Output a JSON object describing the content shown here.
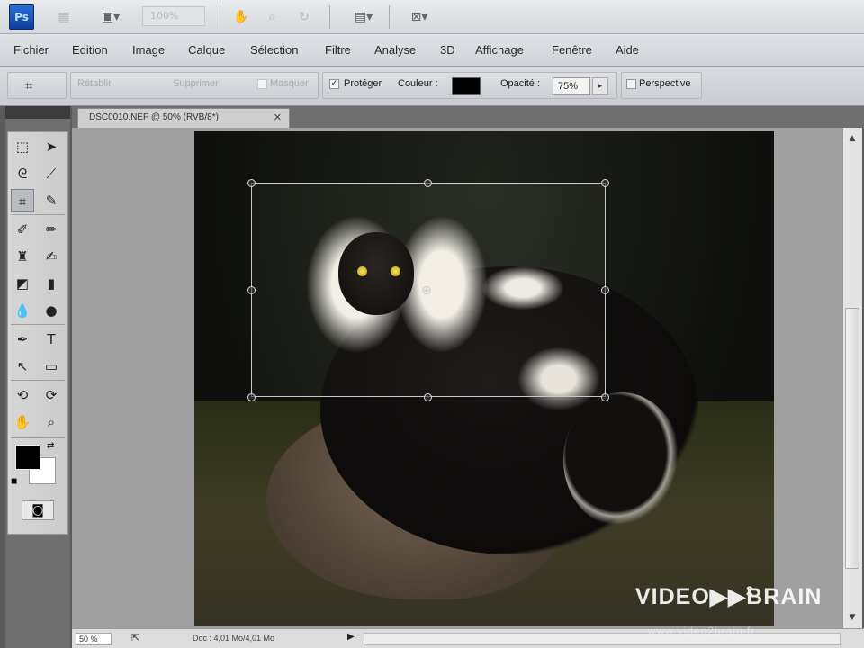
{
  "app": {
    "logo": "Ps",
    "zoom_placeholder": "100%"
  },
  "appbar": {
    "icons": [
      "bridge-icon",
      "screen-mode-icon",
      "hand-icon",
      "zoom-tool-icon",
      "rotate-view-icon",
      "arrange-documents-icon",
      "extras-icon"
    ]
  },
  "menu": {
    "items": [
      "Fichier",
      "Edition",
      "Image",
      "Calque",
      "Sélection",
      "Filtre",
      "Analyse",
      "3D",
      "Affichage",
      "Fenêtre",
      "Aide"
    ]
  },
  "options": {
    "crop_label": "Crop options",
    "cancel_label": "Rétablir",
    "delete_label": "Supprimer",
    "hide_label": "Masquer",
    "protect_label": "Protéger",
    "protect_checked": true,
    "color_label": "Couleur :",
    "shield_color": "#000000",
    "opacity_label": "Opacité :",
    "opacity_value": "75%",
    "perspective_label": "Perspective",
    "perspective_checked": false
  },
  "document": {
    "tab_title": "DSC0010.NEF @ 50% (RVB/8*)",
    "tab_close": "✕"
  },
  "status": {
    "zoom": "50 %",
    "doc_info": "Doc : 4,01 Mo/4,01 Mo",
    "arrow": "▶"
  },
  "watermark": {
    "text_left": "VIDEO",
    "arrows": "▶▶",
    "text_right": "BRAIN",
    "superscript": "2",
    "url": "www.video2brain.fr"
  },
  "colors": {
    "foreground": "#000000",
    "background": "#ffffff",
    "workspace": "#a0a0a0"
  }
}
